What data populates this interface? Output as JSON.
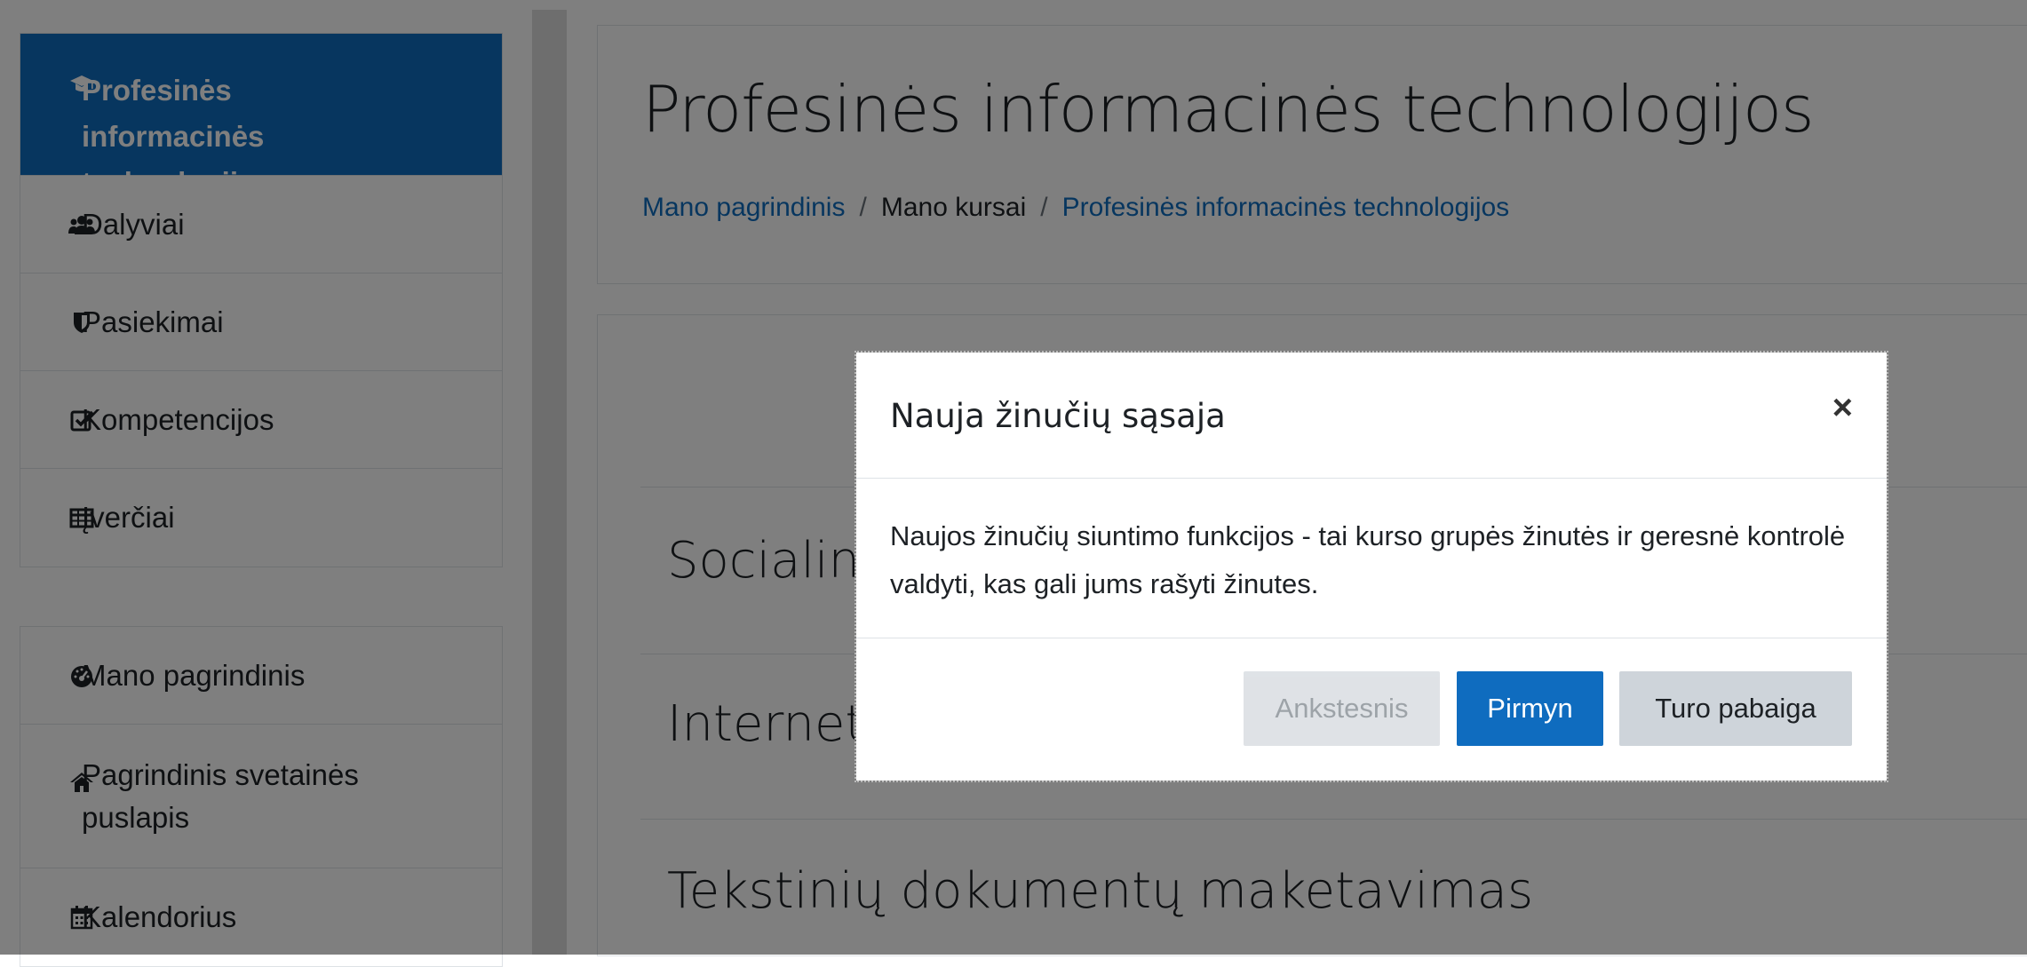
{
  "sidebar": {
    "course_label": "Profesinės informacinės technologijos",
    "items": [
      {
        "label": "Dalyviai",
        "icon": "users-icon"
      },
      {
        "label": "Pasiekimai",
        "icon": "shield-icon"
      },
      {
        "label": "Kompetencijos",
        "icon": "checkbox-icon"
      },
      {
        "label": "Įverčiai",
        "icon": "table-icon"
      }
    ],
    "site_items": [
      {
        "label": "Mano pagrindinis",
        "icon": "dashboard-icon"
      },
      {
        "label": "Pagrindinis svetainės puslapis",
        "icon": "home-icon"
      },
      {
        "label": "Kalendorius",
        "icon": "calendar-icon"
      }
    ]
  },
  "header": {
    "title": "Profesinės informacinės technologijos",
    "breadcrumb": [
      {
        "label": "Mano pagrindinis"
      },
      {
        "label": "Mano kursai"
      },
      {
        "label": "Profesinės informacinės technologijos"
      }
    ],
    "separator": "/"
  },
  "sections": [
    {
      "title": "Socialiniai"
    },
    {
      "title": "Internetas"
    },
    {
      "title": "Tekstinių dokumentų maketavimas"
    }
  ],
  "dialog": {
    "title": "Nauja žinučių sąsaja",
    "close": "×",
    "body": "Naujos žinučių siuntimo funkcijos - tai kurso grupės žinutės ir geresnė kontrolė valdyti, kas gali jums rašyti žinutes.",
    "buttons": {
      "previous": "Ankstesnis",
      "next": "Pirmyn",
      "end": "Turo pabaiga"
    }
  },
  "colors": {
    "primary": "#0f6cbf",
    "secondary": "#ced4da",
    "text": "#1d2125"
  }
}
